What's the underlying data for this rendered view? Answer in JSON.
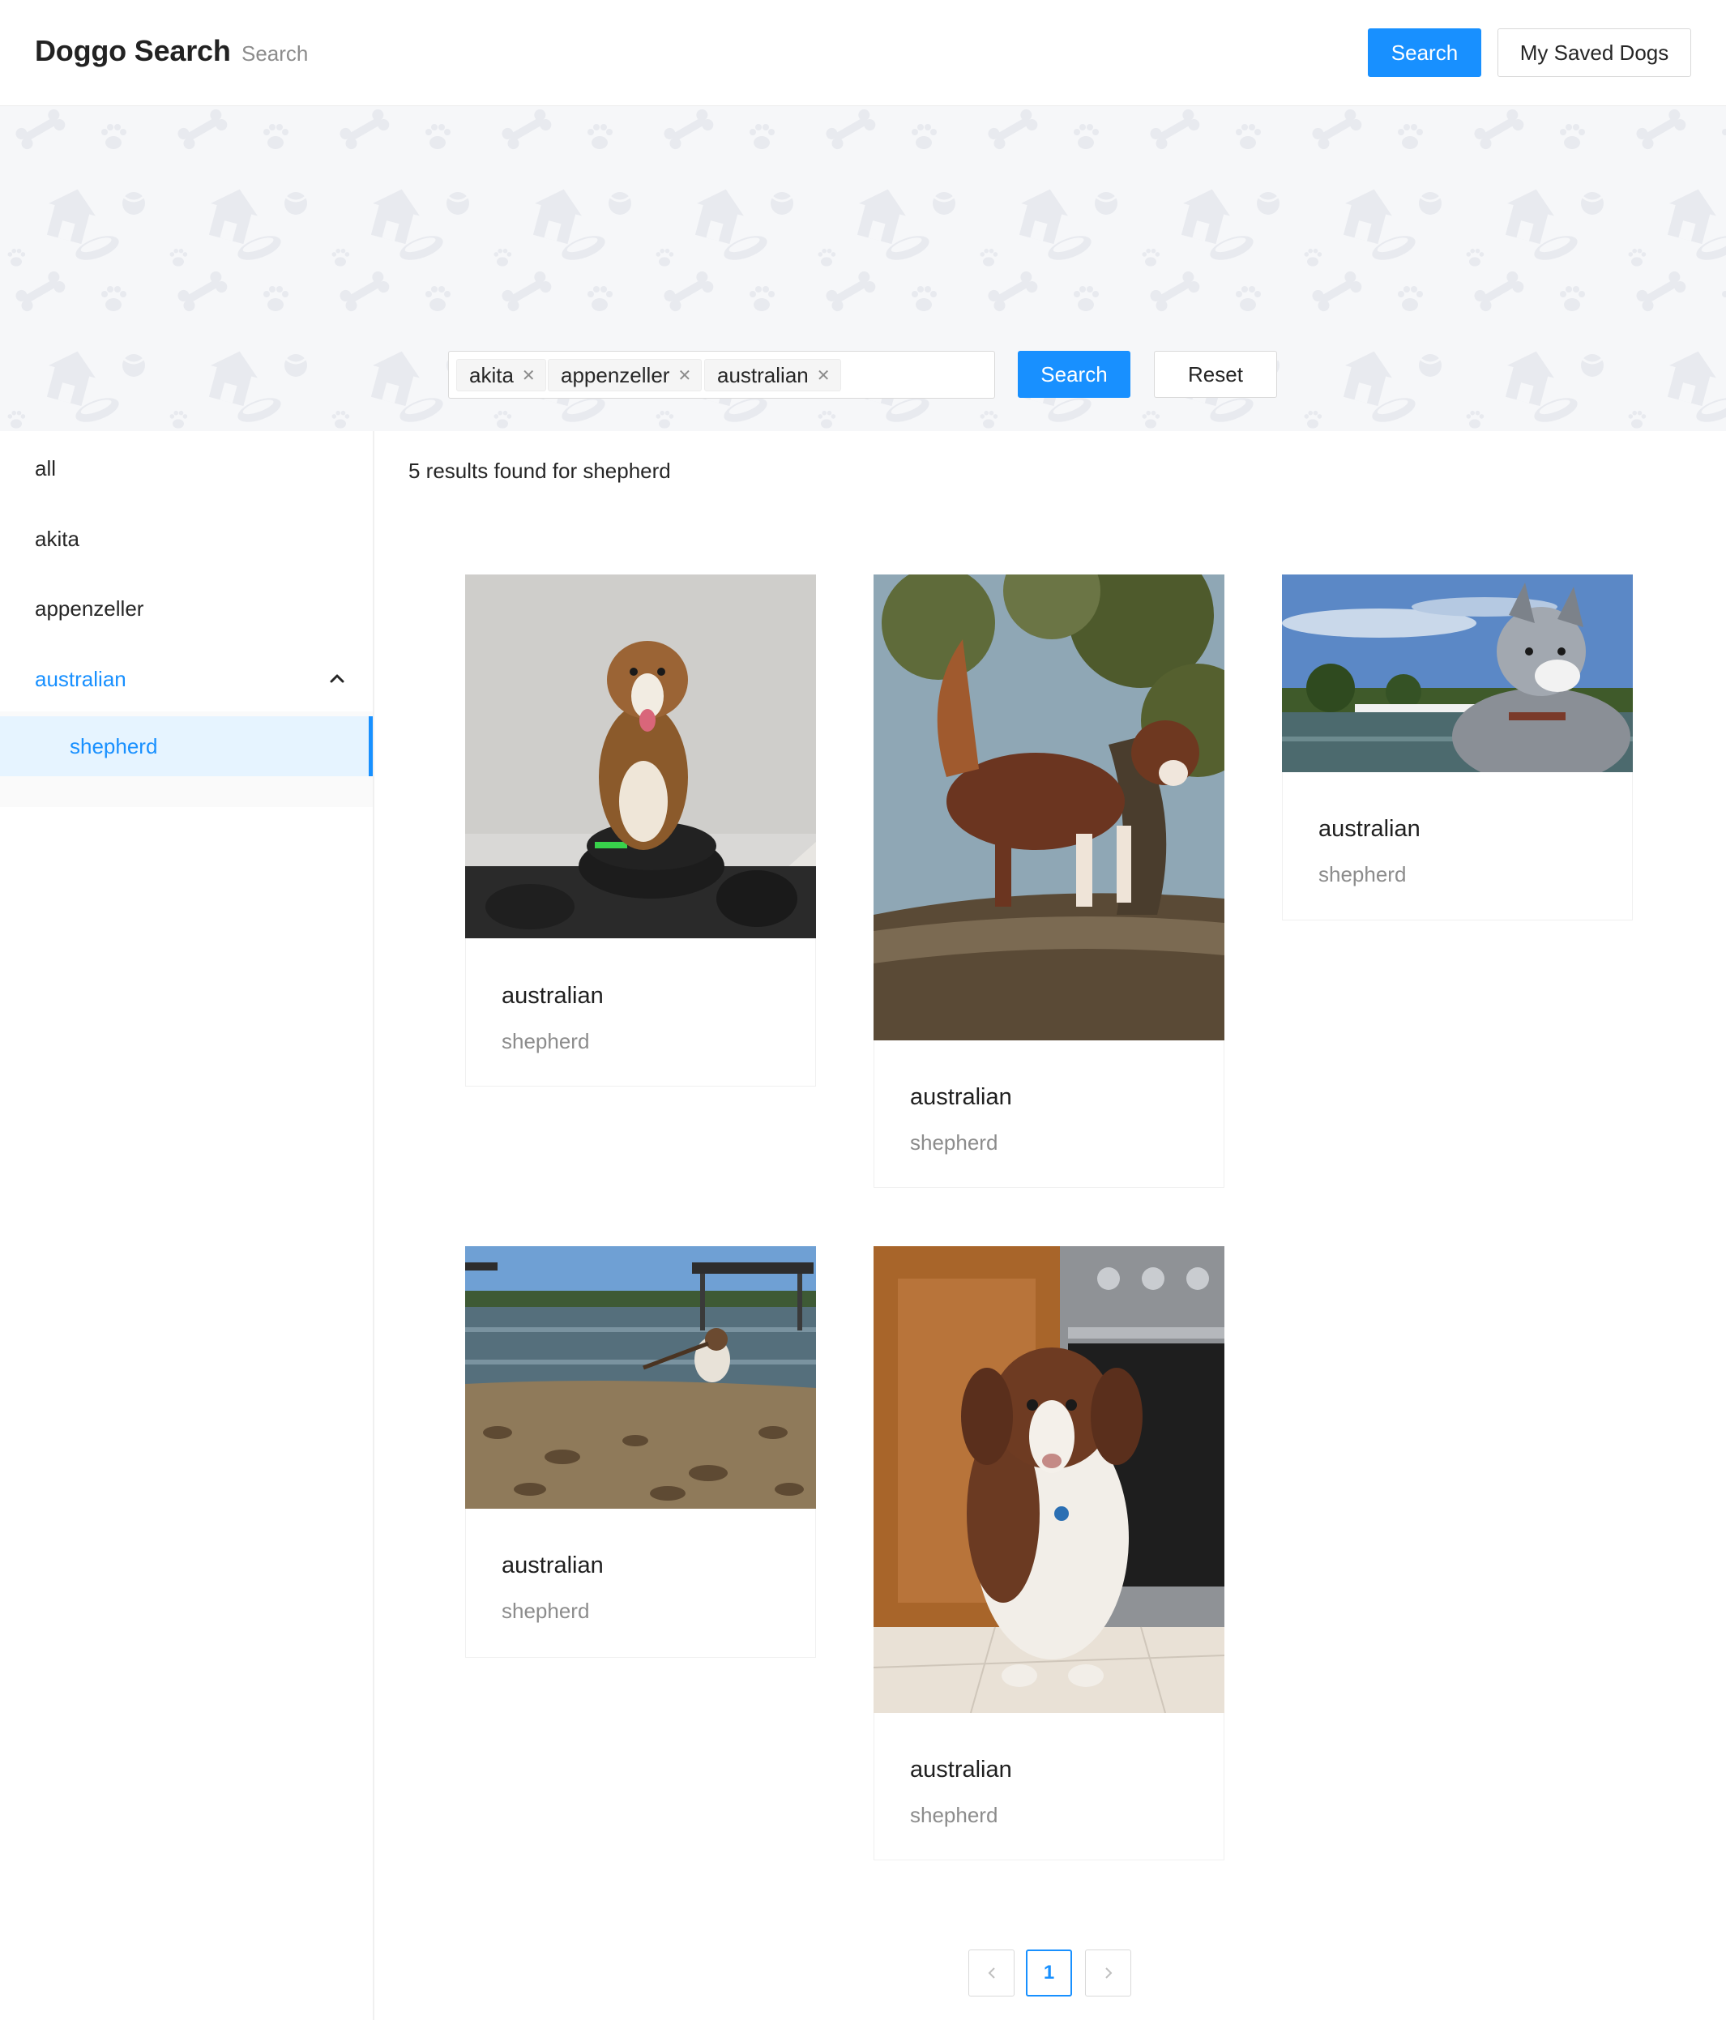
{
  "header": {
    "title": "Doggo Search",
    "subtitle": "Search",
    "search_label": "Search",
    "saved_label": "My Saved Dogs"
  },
  "banner": {
    "tags": [
      {
        "label": "akita"
      },
      {
        "label": "appenzeller"
      },
      {
        "label": "australian"
      }
    ],
    "search_label": "Search",
    "reset_label": "Reset"
  },
  "sidebar": {
    "items": [
      {
        "label": "all"
      },
      {
        "label": "akita"
      },
      {
        "label": "appenzeller"
      },
      {
        "label": "australian"
      }
    ],
    "subitems": [
      {
        "label": "shepherd"
      }
    ]
  },
  "results": {
    "summary": "5 results found for shepherd",
    "cards": [
      {
        "breed": "australian",
        "sub_breed": "shepherd"
      },
      {
        "breed": "australian",
        "sub_breed": "shepherd"
      },
      {
        "breed": "australian",
        "sub_breed": "shepherd"
      },
      {
        "breed": "australian",
        "sub_breed": "shepherd"
      },
      {
        "breed": "australian",
        "sub_breed": "shepherd"
      }
    ]
  },
  "pagination": {
    "current_page": "1"
  },
  "colors": {
    "primary": "#1890ff",
    "banner_bg": "#f6f7f9",
    "selected_bg": "#e6f4ff"
  }
}
